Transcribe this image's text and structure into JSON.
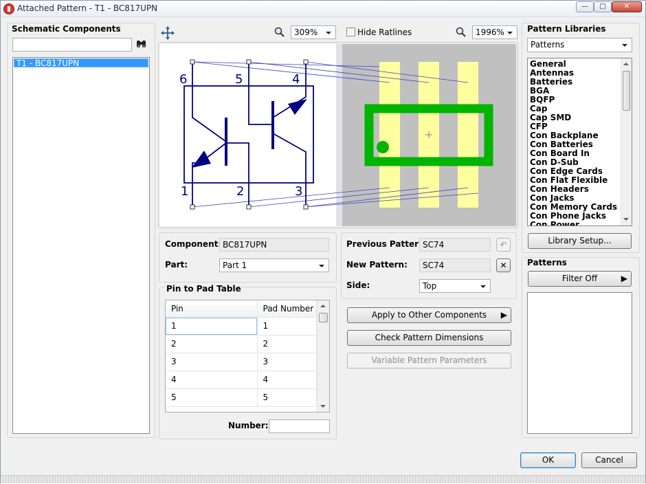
{
  "window": {
    "title": "Attached Pattern   -   T1 - BC817UPN",
    "min": "—",
    "max": "□",
    "close": "✕"
  },
  "left": {
    "heading": "Schematic Components",
    "search_value": "",
    "items": [
      "T1 - BC817UPN"
    ]
  },
  "toolbar": {
    "zoom_schematic": "309%",
    "hide_ratlines_label": "Hide Ratlines",
    "hide_ratlines_checked": false,
    "zoom_pattern": "1996%"
  },
  "schematic": {
    "pin_labels": [
      "6",
      "5",
      "4",
      "1",
      "2",
      "3"
    ],
    "line_color": "#000080",
    "ratline_color": "#4040c0"
  },
  "pattern": {
    "body_color": "#00b400",
    "pad_color": "#ffffa0",
    "background": "#c0c0c0",
    "center_mark": "+"
  },
  "component": {
    "component_label": "Component:",
    "component_value": "BC817UPN",
    "part_label": "Part:",
    "part_value": "Part 1"
  },
  "pin_table": {
    "heading": "Pin to Pad Table",
    "columns": [
      "Pin",
      "Pad Number"
    ],
    "rows": [
      [
        "1",
        "1"
      ],
      [
        "2",
        "2"
      ],
      [
        "3",
        "3"
      ],
      [
        "4",
        "4"
      ],
      [
        "5",
        "5"
      ]
    ],
    "number_label": "Number:",
    "number_value": ""
  },
  "pattern_info": {
    "previous_label": "Previous Pattern:",
    "previous_value": "SC74",
    "new_label": "New Pattern:",
    "new_value": "SC74",
    "side_label": "Side:",
    "side_value": "Top"
  },
  "actions": {
    "apply_other": "Apply to Other Components",
    "check_dims": "Check Pattern Dimensions",
    "variable_params": "Variable Pattern Parameters"
  },
  "libraries": {
    "heading": "Pattern Libraries",
    "selected": "Patterns",
    "items": [
      "General",
      "Antennas",
      "Batteries",
      "BGA",
      "BQFP",
      "Cap",
      "Cap SMD",
      "CFP",
      "Con Backplane",
      "Con Batteries",
      "Con Board In",
      "Con D-Sub",
      "Con Edge Cards",
      "Con Flat Flexible",
      "Con Headers",
      "Con Jacks",
      "Con Memory Cards",
      "Con Phone Jacks",
      "Con Power"
    ],
    "setup_button": "Library Setup..."
  },
  "patterns": {
    "heading": "Patterns",
    "filter_button": "Filter Off"
  },
  "footer": {
    "ok": "OK",
    "cancel": "Cancel"
  },
  "colors": {
    "selection": "#3399ff",
    "selection_text": "#ffffff"
  }
}
